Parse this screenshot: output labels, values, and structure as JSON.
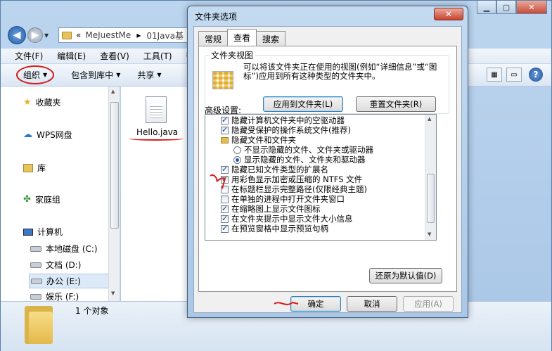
{
  "explorer": {
    "breadcrumb": [
      "MeJuestMe",
      "01Java基"
    ],
    "menu": [
      "文件(F)",
      "编辑(E)",
      "查看(V)",
      "工具(T)",
      "帮助"
    ],
    "toolbar": {
      "organize": "组织",
      "include_library": "包含到库中",
      "share": "共享"
    },
    "nav": {
      "favorites": "收藏夹",
      "wps": "WPS网盘",
      "library": "库",
      "homegroup": "家庭组",
      "computer": "计算机",
      "drives": [
        "本地磁盘 (C:)",
        "文档 (D:)",
        "办公 (E:)",
        "娱乐 (F:)"
      ]
    },
    "file_name": "Hello.java",
    "object_count": "1 个对象"
  },
  "dialog": {
    "title": "文件夹选项",
    "tabs": [
      "常规",
      "查看",
      "搜索"
    ],
    "folder_views": {
      "legend": "文件夹视图",
      "description": "可以将该文件夹正在使用的视图(例如“详细信息”或“图标”)应用到所有这种类型的文件夹中。",
      "apply_button": "应用到文件夹(L)",
      "reset_button": "重置文件夹(R)"
    },
    "advanced_label": "高级设置:",
    "advanced": [
      {
        "type": "checkbox",
        "checked": true,
        "indent": 1,
        "label": "隐藏计算机文件夹中的空驱动器"
      },
      {
        "type": "checkbox",
        "checked": true,
        "indent": 1,
        "label": "隐藏受保护的操作系统文件(推荐)"
      },
      {
        "type": "folder",
        "checked": false,
        "indent": 1,
        "label": "隐藏文件和文件夹"
      },
      {
        "type": "radio",
        "checked": false,
        "indent": 2,
        "label": "不显示隐藏的文件、文件夹或驱动器"
      },
      {
        "type": "radio",
        "checked": true,
        "indent": 2,
        "label": "显示隐藏的文件、文件夹和驱动器"
      },
      {
        "type": "checkbox",
        "checked": true,
        "indent": 1,
        "label": "隐藏已知文件类型的扩展名"
      },
      {
        "type": "checkbox",
        "checked": true,
        "indent": 1,
        "label": "用彩色显示加密或压缩的 NTFS 文件"
      },
      {
        "type": "checkbox",
        "checked": false,
        "indent": 1,
        "label": "在标题栏显示完整路径(仅限经典主题)"
      },
      {
        "type": "checkbox",
        "checked": false,
        "indent": 1,
        "label": "在单独的进程中打开文件夹窗口"
      },
      {
        "type": "checkbox",
        "checked": true,
        "indent": 1,
        "label": "在缩略图上显示文件图标"
      },
      {
        "type": "checkbox",
        "checked": true,
        "indent": 1,
        "label": "在文件夹提示中显示文件大小信息"
      },
      {
        "type": "checkbox",
        "checked": true,
        "indent": 1,
        "label": "在预览窗格中显示预览句柄"
      }
    ],
    "restore_defaults": "还原为默认值(D)",
    "ok": "确定",
    "cancel": "取消",
    "apply": "应用(A)"
  },
  "colors": {
    "annotation_red": "#d41c1c",
    "accent_blue": "#1e57b0"
  },
  "icons": [
    "search-icon",
    "help-icon",
    "close-icon",
    "folder-icon",
    "star-icon",
    "cloud-icon"
  ]
}
